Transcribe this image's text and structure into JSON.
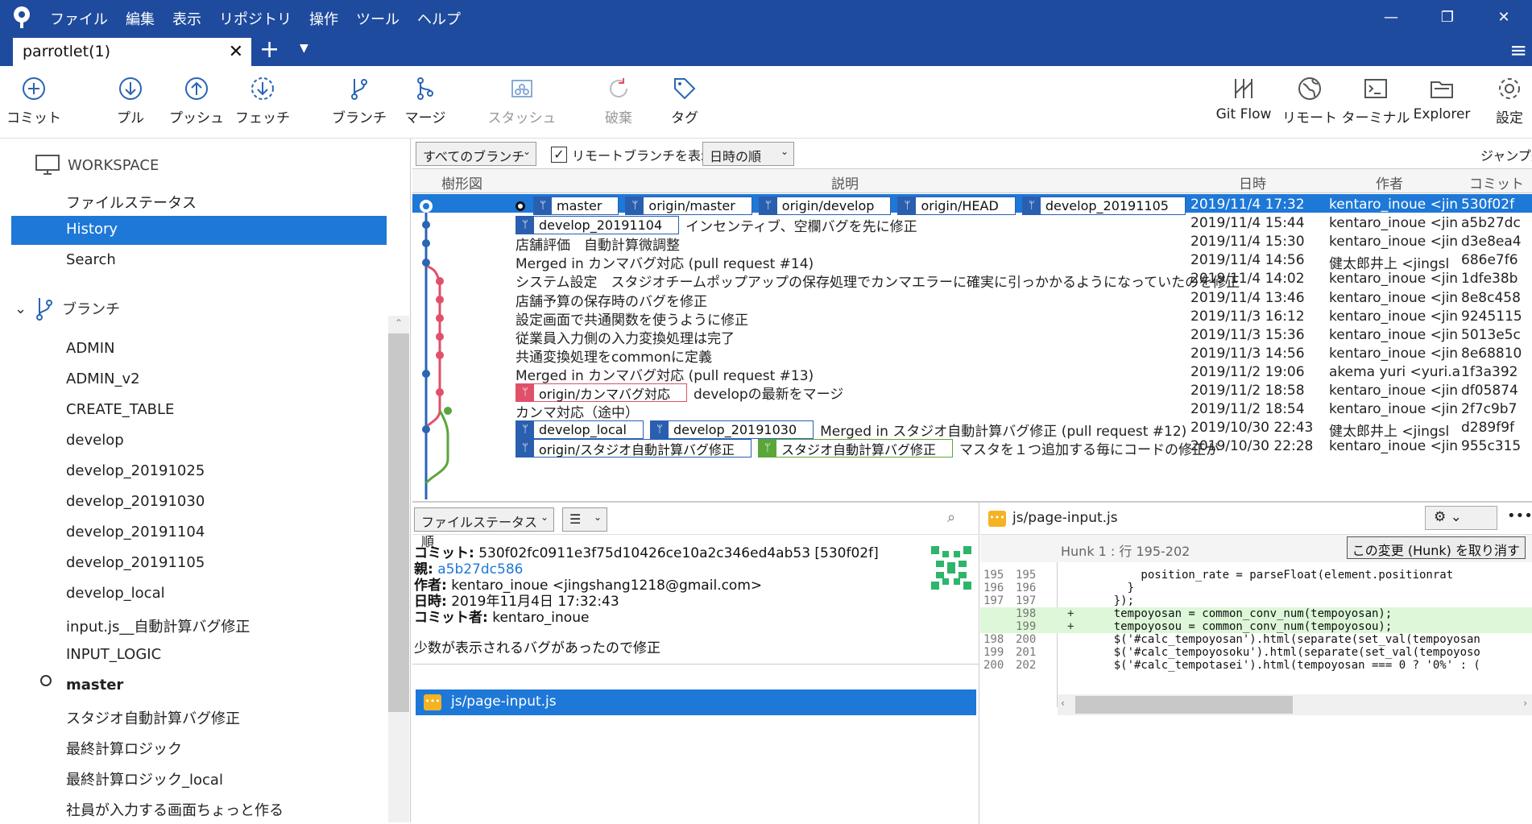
{
  "titlebar": {
    "menu": [
      "ファイル",
      "編集",
      "表示",
      "リポジトリ",
      "操作",
      "ツール",
      "ヘルプ"
    ]
  },
  "tab": {
    "title": "parrotlet(1)"
  },
  "toolbar": {
    "commit": "コミット",
    "pull": "プル",
    "push": "プッシュ",
    "fetch": "フェッチ",
    "branch": "ブランチ",
    "merge": "マージ",
    "stash": "スタッシュ",
    "discard": "破棄",
    "tag": "タグ",
    "gitflow": "Git Flow",
    "remote": "リモート",
    "terminal": "ターミナル",
    "explorer": "Explorer",
    "settings": "設定"
  },
  "sidebar": {
    "workspace": "WORKSPACE",
    "file_status": "ファイルステータス",
    "history": "History",
    "search": "Search",
    "branches_header": "ブランチ",
    "branches": [
      "ADMIN",
      "ADMIN_v2",
      "CREATE_TABLE",
      "develop",
      "develop_20191025",
      "develop_20191030",
      "develop_20191104",
      "develop_20191105",
      "develop_local",
      "input.js__自動計算バグ修正",
      "INPUT_LOGIC",
      "master",
      "スタジオ自動計算バグ修正",
      "最終計算ロジック",
      "最終計算ロジック_local",
      "社員が入力する画面ちょっと作る"
    ]
  },
  "filter": {
    "all_branches": "すべてのブランチ",
    "show_remote": "リモートブランチを表示",
    "order": "日時の順",
    "jump": "ジャンプ先"
  },
  "grid": {
    "headers": {
      "graph": "樹形図",
      "desc": "説明",
      "date": "日時",
      "author": "作者",
      "commit": "コミット"
    },
    "rows": [
      {
        "tags": [
          [
            "",
            "master"
          ],
          [
            "",
            "origin/master"
          ],
          [
            "",
            "origin/develop"
          ],
          [
            "",
            "origin/HEAD"
          ],
          [
            "",
            "develop_20191105"
          ]
        ],
        "msg": "",
        "date": "2019/11/4  17:32",
        "author": "kentaro_inoue <jin",
        "hash": "530f02f"
      },
      {
        "tags": [
          [
            "",
            "develop_20191104"
          ]
        ],
        "msg": "インセンティブ、空欄バグを先に修正",
        "date": "2019/11/4  15:44",
        "author": "kentaro_inoue <jin",
        "hash": "a5b27dc"
      },
      {
        "tags": [],
        "msg": "店舗評価　自動計算微調整",
        "date": "2019/11/4  15:30",
        "author": "kentaro_inoue <jin",
        "hash": "d3e8ea4"
      },
      {
        "tags": [],
        "msg": "Merged in カンマバグ対応 (pull request #14)",
        "date": "2019/11/4  14:56",
        "author": "健太郎井上 <jingsl",
        "hash": "686e7f6"
      },
      {
        "tags": [],
        "msg": "システム設定　スタジオチームポップアップの保存処理でカンマエラーに確実に引っかかるようになっていたのを修正",
        "date": "2019/11/4  14:02",
        "author": "kentaro_inoue <jin",
        "hash": "1dfe38b"
      },
      {
        "tags": [],
        "msg": "店舗予算の保存時のバグを修正",
        "date": "2019/11/4  13:46",
        "author": "kentaro_inoue <jin",
        "hash": "8e8c458"
      },
      {
        "tags": [],
        "msg": "設定画面で共通関数を使うように修正",
        "date": "2019/11/3  16:12",
        "author": "kentaro_inoue <jin",
        "hash": "9245115"
      },
      {
        "tags": [],
        "msg": "従業員入力側の入力変換処理は完了",
        "date": "2019/11/3  15:36",
        "author": "kentaro_inoue <jin",
        "hash": "5013e5c"
      },
      {
        "tags": [],
        "msg": "共通変換処理をcommonに定義",
        "date": "2019/11/3  14:56",
        "author": "kentaro_inoue <jin",
        "hash": "8e68810"
      },
      {
        "tags": [],
        "msg": "Merged in カンマバグ対応 (pull request #13)",
        "date": "2019/11/2  19:06",
        "author": "akema yuri <yuri.a",
        "hash": "1f3a392"
      },
      {
        "tags": [
          [
            "red",
            "origin/カンマバグ対応"
          ]
        ],
        "msg": "developの最新をマージ",
        "date": "2019/11/2  18:58",
        "author": "kentaro_inoue <jin",
        "hash": "df05874"
      },
      {
        "tags": [],
        "msg": "カンマ対応（途中）",
        "date": "2019/11/2  18:54",
        "author": "kentaro_inoue <jin",
        "hash": "2f7c9b7"
      },
      {
        "tags": [
          [
            "",
            "develop_local"
          ],
          [
            "",
            "develop_20191030"
          ]
        ],
        "msg": "Merged in スタジオ自動計算バグ修正 (pull request #12)",
        "date": "2019/10/30  22:43",
        "author": "健太郎井上 <jingsl",
        "hash": "d289f9f"
      },
      {
        "tags": [
          [
            "",
            "origin/スタジオ自動計算バグ修正"
          ],
          [
            "grn",
            "スタジオ自動計算バグ修正"
          ]
        ],
        "msg": "マスタを１つ追加する毎にコードの修正が",
        "date": "2019/10/30  22:28",
        "author": "kentaro_inoue <jin",
        "hash": "955c315"
      }
    ]
  },
  "commit_detail": {
    "sort": "ファイルステータス順",
    "commit_label": "コミット:",
    "commit_value": "530f02fc0911e3f75d10426ce10a2c346ed4ab53 [530f02f]",
    "parent_label": "親:",
    "parent_value": "a5b27dc586",
    "author_label": "作者:",
    "author_value": "kentaro_inoue <jingshang1218@gmail.com>",
    "date_label": "日時:",
    "date_value": "2019年11月4日 17:32:43",
    "committer_label": "コミット者:",
    "committer_value": "kentaro_inoue",
    "message": "少数が表示されるバグがあったので修正",
    "file": "js/page-input.js"
  },
  "diff": {
    "file": "js/page-input.js",
    "hunk_label": "Hunk 1 : 行 195-202",
    "discard_button": "この変更 (Hunk) を取り消す",
    "lines": [
      {
        "o": "195",
        "n": "195",
        "pm": "",
        "code": "        position_rate = parseFloat(element.positionrat",
        "add": false
      },
      {
        "o": "196",
        "n": "196",
        "pm": "",
        "code": "      }",
        "add": false
      },
      {
        "o": "197",
        "n": "197",
        "pm": "",
        "code": "    });",
        "add": false
      },
      {
        "o": "",
        "n": "198",
        "pm": "+",
        "code": "    tempoyosan = common_conv_num(tempoyosan);",
        "add": true
      },
      {
        "o": "",
        "n": "199",
        "pm": "+",
        "code": "    tempoyosou = common_conv_num(tempoyosou);",
        "add": true
      },
      {
        "o": "198",
        "n": "200",
        "pm": "",
        "code": "    $('#calc_tempoyosan').html(separate(set_val(tempoyosan",
        "add": false
      },
      {
        "o": "199",
        "n": "201",
        "pm": "",
        "code": "    $('#calc_tempoyosoku').html(separate(set_val(tempoyoso",
        "add": false
      },
      {
        "o": "200",
        "n": "202",
        "pm": "",
        "code": "    $('#calc_tempotasei').html(tempoyosan === 0 ? '0%' : (",
        "add": false
      }
    ]
  },
  "colors": {
    "accent": "#1e78d7",
    "titlebar": "#1f4b9e",
    "graph_blue": "#2a64b4",
    "graph_red": "#e0506a",
    "graph_green": "#5aa63a"
  }
}
